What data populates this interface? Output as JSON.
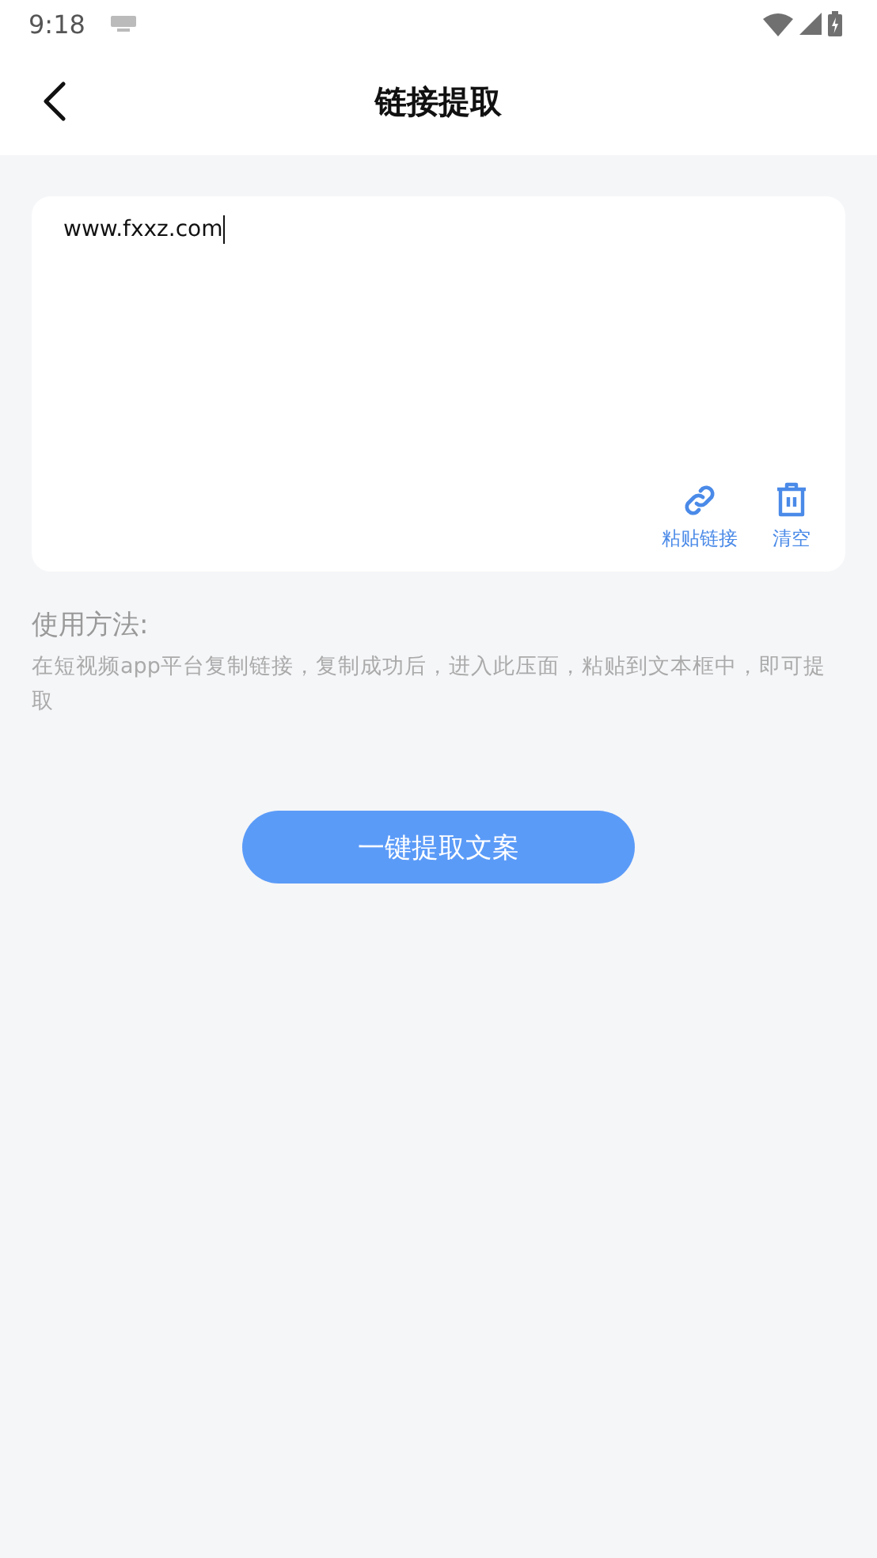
{
  "status_bar": {
    "time": "9:18"
  },
  "header": {
    "title": "链接提取"
  },
  "link_field": {
    "value": "www.fxxz.com"
  },
  "actions": [
    {
      "kind": "paste",
      "label": "粘贴链接"
    },
    {
      "kind": "clear",
      "label": "清空"
    }
  ],
  "instructions": {
    "heading": "使用方法:",
    "text": "在短视频app平台复制链接，复制成功后，进入此压面，粘贴到文本框中，即可提取"
  },
  "submit_button": {
    "label": "一键提取文案"
  }
}
